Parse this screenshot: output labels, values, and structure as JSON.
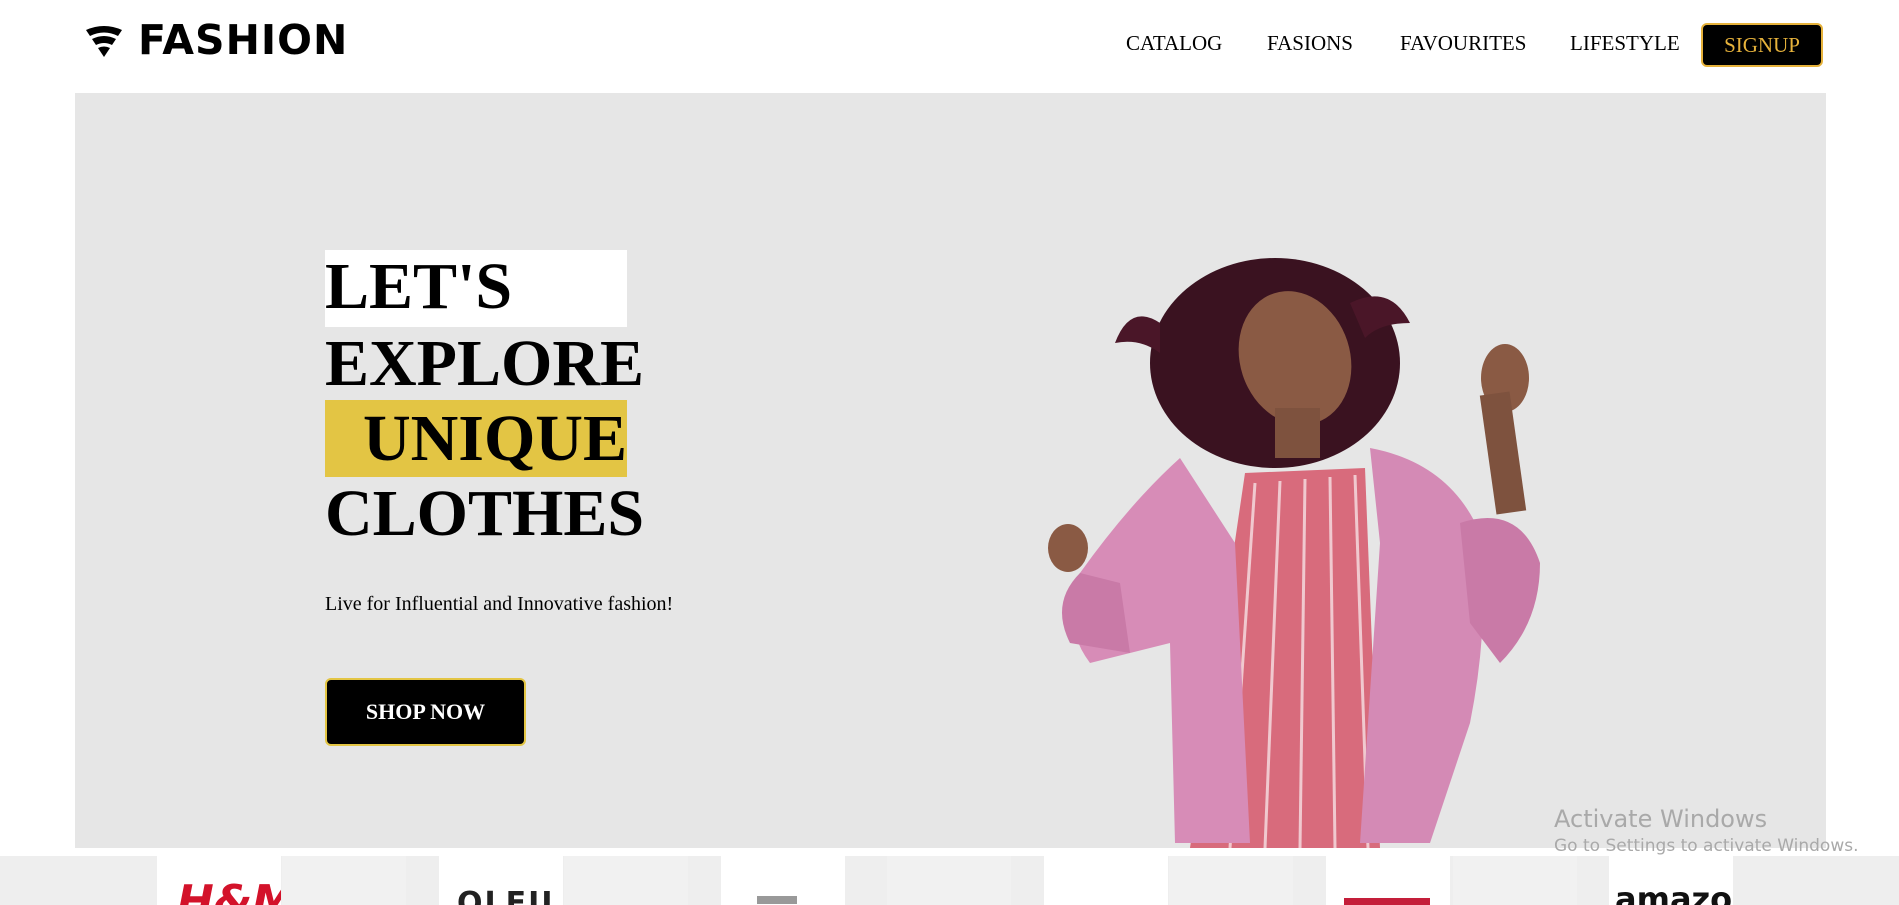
{
  "brand": {
    "name": "FASHION",
    "icon": "wifi-wedge-logo-icon"
  },
  "nav": {
    "items": [
      {
        "label": "CATALOG"
      },
      {
        "label": "FASIONS"
      },
      {
        "label": "FAVOURITES"
      },
      {
        "label": "LIFESTYLE"
      }
    ],
    "signup_label": "SIGNUP"
  },
  "hero": {
    "headline": [
      "LET'S",
      "EXPLORE",
      "UNIQUE",
      "CLOTHES"
    ],
    "tagline": "Live for Influential and Innovative fashion!",
    "cta_label": "SHOP NOW",
    "image": "woman-in-pink-fur-coat-photo"
  },
  "brands": {
    "logos": [
      {
        "name": "hm-logo",
        "text": "H&M"
      },
      {
        "name": "oleu-logo",
        "text": "OLEU"
      },
      {
        "name": "levis-logo",
        "text": ""
      },
      {
        "name": "amazon-logo",
        "text": "amazon"
      }
    ]
  },
  "watermark": {
    "title": "Activate Windows",
    "subtitle": "Go to Settings to activate Windows."
  },
  "colors": {
    "accent_yellow": "#e3c544",
    "signup_text": "#e6b23b",
    "hero_bg": "#e6e6e6",
    "coat_pink": "#d78cb7"
  }
}
